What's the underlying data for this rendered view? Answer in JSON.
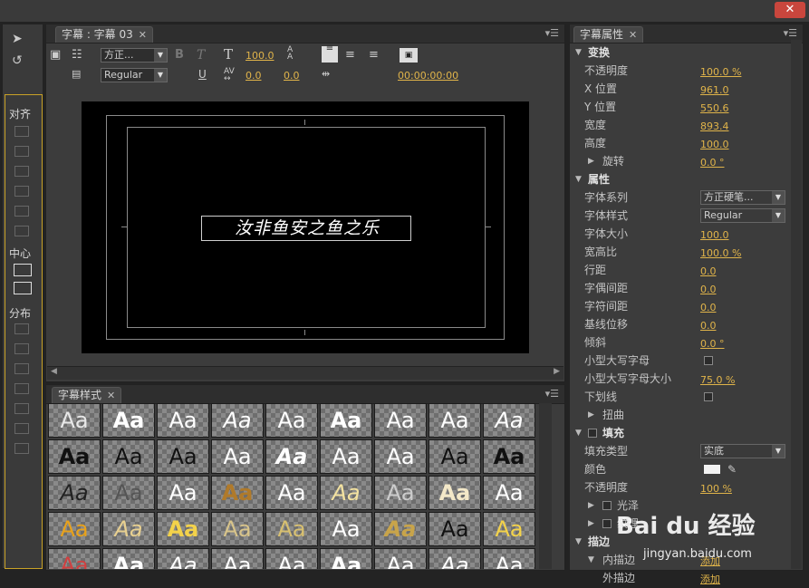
{
  "window": {
    "close_label": "✕"
  },
  "tools": {
    "align_title": "对齐",
    "center_title": "中心",
    "distribute_title": "分布"
  },
  "title_panel": {
    "tab_label": "字幕 : 字幕 03",
    "font_family": "方正...",
    "font_style": "Regular",
    "font_size": "100.0",
    "kerning": "0.0",
    "leading": "0.0",
    "baseline": "0.0",
    "timecode": "00:00:00:00",
    "bold_label": "B",
    "italic_label": "T",
    "underline_label": "U",
    "caption_text": "汝非鱼安之鱼之乐"
  },
  "styles_panel": {
    "tab_label": "字幕样式",
    "swatch_text": "Aa",
    "swatches": [
      {
        "color": "#e8e8e8"
      },
      {
        "color": "#ffffff"
      },
      {
        "color": "#ffffff"
      },
      {
        "color": "#ffffff"
      },
      {
        "color": "#ffffff"
      },
      {
        "color": "#ffffff"
      },
      {
        "color": "#ffffff"
      },
      {
        "color": "#ffffff"
      },
      {
        "color": "#ffffff"
      },
      {
        "color": "#111111"
      },
      {
        "color": "#111111"
      },
      {
        "color": "#111111"
      },
      {
        "color": "#ffffff"
      },
      {
        "color": "#ffffff"
      },
      {
        "color": "#ffffff"
      },
      {
        "color": "#ffffff"
      },
      {
        "color": "#111111"
      },
      {
        "color": "#111111"
      },
      {
        "color": "#222222"
      },
      {
        "color": "#555555"
      },
      {
        "color": "#ffffff"
      },
      {
        "color": "#b07a2a"
      },
      {
        "color": "#ffffff"
      },
      {
        "color": "#f3e2a0"
      },
      {
        "color": "#cccccc"
      },
      {
        "color": "#f3e8c8"
      },
      {
        "color": "#ffffff"
      },
      {
        "color": "#e8a21c"
      },
      {
        "color": "#e8d090"
      },
      {
        "color": "#f3d24a"
      },
      {
        "color": "#d8c48a"
      },
      {
        "color": "#d8c070"
      },
      {
        "color": "#ffffff"
      },
      {
        "color": "#c8a44a"
      },
      {
        "color": "#111111"
      },
      {
        "color": "#f3d24a"
      },
      {
        "color": "#d04040"
      },
      {
        "color": "#ffffff"
      },
      {
        "color": "#ffffff"
      },
      {
        "color": "#ffffff"
      },
      {
        "color": "#ffffff"
      },
      {
        "color": "#ffffff"
      },
      {
        "color": "#ffffff"
      },
      {
        "color": "#ffffff"
      },
      {
        "color": "#ffffff"
      }
    ]
  },
  "properties_panel": {
    "tab_label": "字幕属性",
    "rows": [
      {
        "label": "变换",
        "kind": "group",
        "tri": "down"
      },
      {
        "label": "不透明度",
        "value": "100.0 %"
      },
      {
        "label": "X 位置",
        "value": "961.0"
      },
      {
        "label": "Y 位置",
        "value": "550.6"
      },
      {
        "label": "宽度",
        "value": "893.4"
      },
      {
        "label": "高度",
        "value": "100.0"
      },
      {
        "label": "旋转",
        "value": "0.0 °",
        "tri": "right",
        "indent": true
      },
      {
        "label": "属性",
        "kind": "group",
        "tri": "down"
      },
      {
        "label": "字体系列",
        "dropdown": "方正硬笔..."
      },
      {
        "label": "字体样式",
        "dropdown": "Regular"
      },
      {
        "label": "字体大小",
        "value": "100.0"
      },
      {
        "label": "宽高比",
        "value": "100.0 %"
      },
      {
        "label": "行距",
        "value": "0.0"
      },
      {
        "label": "字偶间距",
        "value": "0.0"
      },
      {
        "label": "字符间距",
        "value": "0.0"
      },
      {
        "label": "基线位移",
        "value": "0.0"
      },
      {
        "label": "倾斜",
        "value": "0.0 °"
      },
      {
        "label": "小型大写字母",
        "checkbox": true
      },
      {
        "label": "小型大写字母大小",
        "value": "75.0 %"
      },
      {
        "label": "下划线",
        "checkbox": true
      },
      {
        "label": "扭曲",
        "tri": "right",
        "indent": true
      },
      {
        "label": "填充",
        "kind": "group",
        "tri": "down",
        "check": true
      },
      {
        "label": "填充类型",
        "dropdown": "实底"
      },
      {
        "label": "颜色",
        "swatch": "#f2f2f2"
      },
      {
        "label": "不透明度",
        "value": "100 %"
      },
      {
        "label": "光泽",
        "tri": "right",
        "indent": true,
        "check": true
      },
      {
        "label": "纹理",
        "tri": "right",
        "indent": true,
        "check": true
      },
      {
        "label": "描边",
        "kind": "group",
        "tri": "down"
      },
      {
        "label": "内描边",
        "tri": "down",
        "indent": true,
        "value": "添加"
      },
      {
        "label": "外描边",
        "value": "添加",
        "indent": true
      }
    ]
  },
  "watermark": {
    "text": "Bai du 经验",
    "url": "jingyan.baidu.com"
  }
}
